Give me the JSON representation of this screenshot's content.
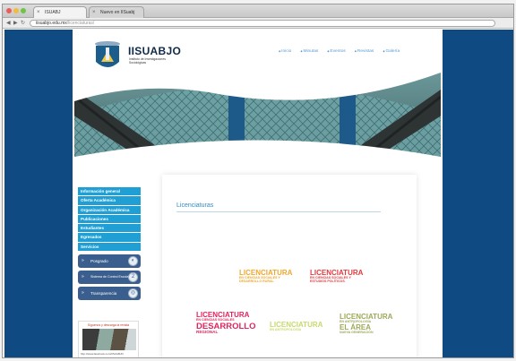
{
  "browser": {
    "tabs": [
      "ISUABJ",
      "Nuevo en IISuabj"
    ],
    "url_domain": "iisuabjo.edu.mx",
    "url_path": "/licenciaturas/"
  },
  "header": {
    "site_name": "IISUABJO",
    "site_subtitle": "Instituto de Investigaciones Sociológicas",
    "nav": [
      "Inicio",
      "Minutas",
      "Eventos",
      "Revistas",
      "Galería"
    ]
  },
  "sidebar": {
    "menu": [
      "Información general",
      "Oferta Académica",
      "Organización Académica",
      "Publicaciones",
      "Estudiantes",
      "Egresados",
      "Servicios"
    ],
    "buttons": [
      {
        "label": "Posgrado"
      },
      {
        "label": "Sistema de Control Escolar"
      },
      {
        "label": "Transparencia"
      }
    ],
    "promo_title": "Síguenos y descarga la revista",
    "promo_url": "http://www.facebook.com/IISUABJO"
  },
  "content": {
    "title": "Licenciaturas",
    "tiles": [
      {
        "big": "LICENCIATURA",
        "sm": "EN CIENCIAS SOCIALES Y DESARROLLO RURAL",
        "color": "#f2a628"
      },
      {
        "big": "LICENCIATURA",
        "sm": "EN CIENCIAS SOCIALES Y ESTUDIOS POLÍTICOS",
        "color": "#e5373c"
      },
      {
        "big": "LICENCIATURA",
        "sm": "EN CIENCIAS SOCIALES",
        "big2": "DESARROLLO",
        "sm2": "REGIONAL",
        "color": "#e0245e"
      },
      {
        "big": "LICENCIATURA",
        "sm": "EN ANTROPOLOGÍA",
        "color": "#c8d96a"
      },
      {
        "big": "LICENCIATURA",
        "sm": "EN ANTROPOLOGÍA",
        "big2": "EL ÁREA",
        "sm2": "NUEVA GENERACIÓN",
        "color": "#9ea85a"
      }
    ]
  },
  "colors": {
    "side_blue": "#0f4a82",
    "menu_blue": "#1f9fd4",
    "title_blue": "#2c8bc9"
  }
}
